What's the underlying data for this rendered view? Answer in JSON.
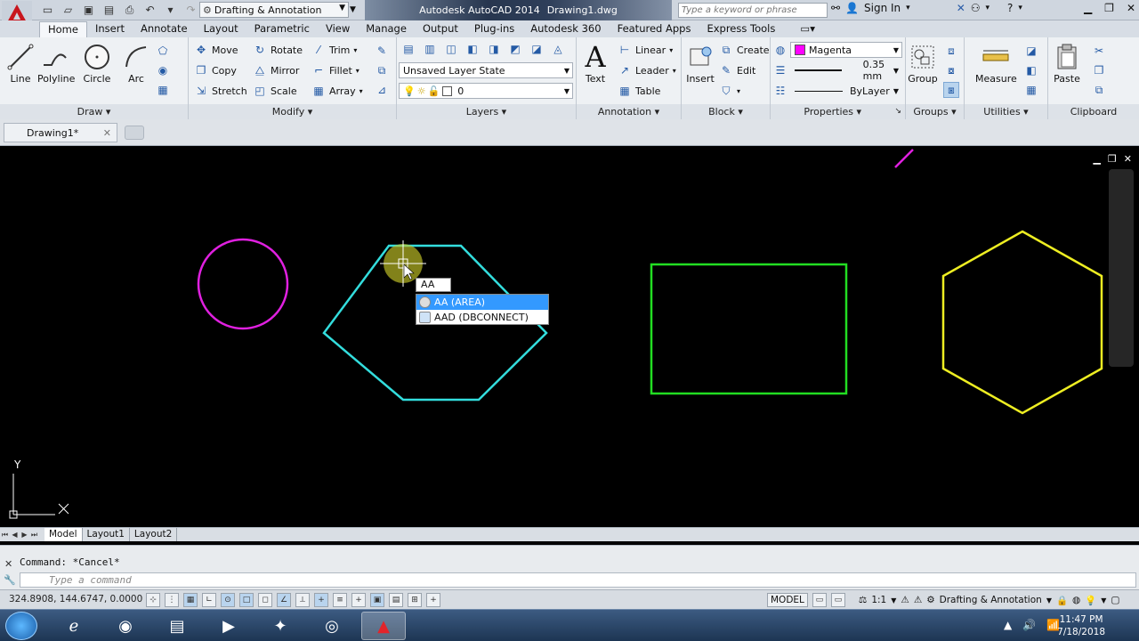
{
  "title": {
    "app_name": "Autodesk AutoCAD 2014",
    "file_name": "Drawing1.dwg",
    "workspace": "Drafting & Annotation",
    "search_placeholder": "Type a keyword or phrase",
    "sign_in": "Sign In"
  },
  "tabs": [
    "Home",
    "Insert",
    "Annotate",
    "Layout",
    "Parametric",
    "View",
    "Manage",
    "Output",
    "Plug-ins",
    "Autodesk 360",
    "Featured Apps",
    "Express Tools"
  ],
  "ribbon": {
    "draw": {
      "title": "Draw",
      "tools": [
        "Line",
        "Polyline",
        "Circle",
        "Arc"
      ]
    },
    "modify": {
      "title": "Modify",
      "tools": [
        "Move",
        "Rotate",
        "Trim",
        "Copy",
        "Mirror",
        "Fillet",
        "Stretch",
        "Scale",
        "Array"
      ]
    },
    "layers": {
      "title": "Layers",
      "layer_state": "Unsaved Layer State",
      "current_layer": "0"
    },
    "annotation": {
      "title": "Annotation",
      "text": "Text",
      "linear": "Linear",
      "leader": "Leader",
      "table": "Table"
    },
    "block": {
      "title": "Block",
      "insert": "Insert",
      "create": "Create",
      "edit": "Edit"
    },
    "properties": {
      "title": "Properties",
      "color": "Magenta",
      "lineweight": "0.35 mm",
      "linetype": "ByLayer",
      "color_hex": "#ff00ff"
    },
    "groups": {
      "title": "Groups",
      "group": "Group"
    },
    "utilities": {
      "title": "Utilities",
      "measure": "Measure"
    },
    "clipboard": {
      "title": "Clipboard",
      "paste": "Paste"
    }
  },
  "doc_tab": {
    "name": "Drawing1*"
  },
  "autocomplete": {
    "typed": "AA",
    "items": [
      {
        "label": "AA (AREA)",
        "selected": true
      },
      {
        "label": "AAD (DBCONNECT)",
        "selected": false
      }
    ]
  },
  "ucs": {
    "y": "Y"
  },
  "layout_tabs": [
    "Model",
    "Layout1",
    "Layout2"
  ],
  "command": {
    "history": "Command: *Cancel*",
    "placeholder": "Type a command"
  },
  "status": {
    "coords": "324.8908, 144.6747, 0.0000",
    "model": "MODEL",
    "scale": "1:1",
    "workspace": "Drafting & Annotation"
  },
  "clock": {
    "time": "11:47 PM",
    "date": "7/18/2018"
  },
  "colors": {
    "circle": "#e020e0",
    "hexagon_left": "#33dddd",
    "rectangle": "#22dd22",
    "hexagon_right": "#eeee22",
    "accent_line": "#e020e0"
  }
}
